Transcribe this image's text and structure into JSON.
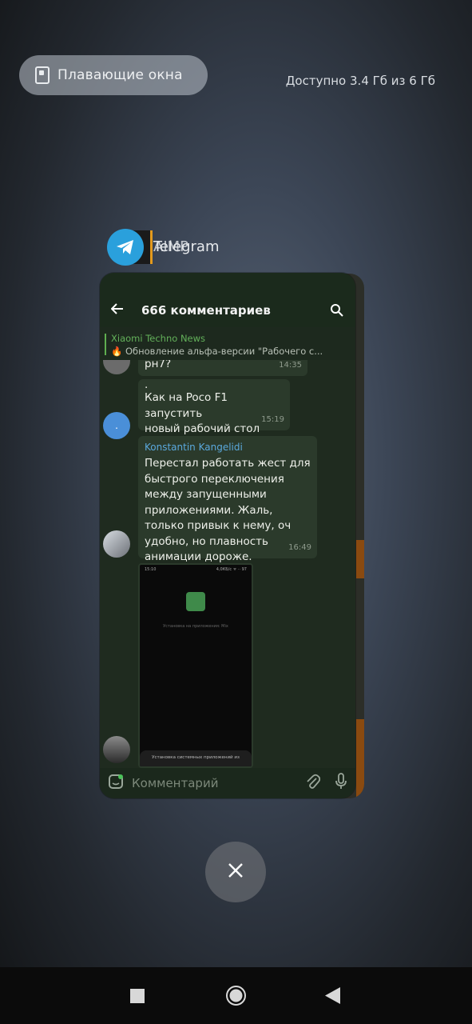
{
  "floating_windows_label": "Плавающие окна",
  "memory_text": "Доступно 3.4 Гб из 6 Гб",
  "recent_apps": {
    "front_label": "Telegram",
    "back_label": "AIMP"
  },
  "telegram": {
    "title": "666 комментариев",
    "pinned_source": "Xiaomi Techno News",
    "pinned_text": "🔥 Обновление альфа-версии \"Рабочего с...",
    "input_placeholder": "Комментарий",
    "messages": [
      {
        "text": "рн7?",
        "time": "14:35"
      },
      {
        "text_line1": ".",
        "text_line2": "Как на Poco F1 запустить",
        "text_line3": "новый рабочий стол",
        "time": "15:19"
      },
      {
        "author": "Konstantin Kangelidi",
        "text": "Перестал работать жест для быстрого переключения между запущенными приложениями. Жаль, только привык к нему, оч удобно, но плавность анимации дороже.",
        "time": "16:49"
      }
    ],
    "avatar_dot": ".",
    "screenshot": {
      "status_time": "15:10",
      "status_right": "4,0КБ/с ᯤ ⋅⋅ 97",
      "caption": "Установка на приложения: Mix",
      "sheet_text": "Установка системных приложений из"
    }
  },
  "close_icon": "close-icon",
  "colors": {
    "telegram_blue": "#2aa0dc",
    "aimp_orange": "#e39a1d",
    "chat_bg": "#1f2b1f",
    "bubble_bg": "#2b3a2b"
  }
}
